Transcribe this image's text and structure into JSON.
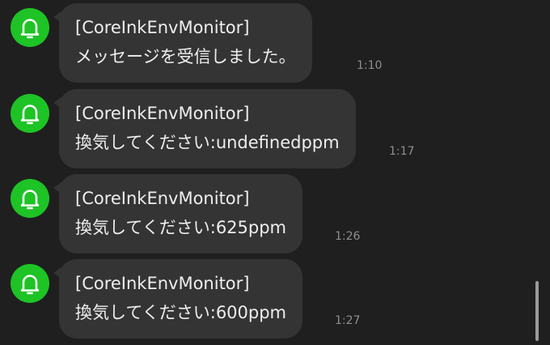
{
  "messages": [
    {
      "sender": "[CoreInkEnvMonitor]",
      "text": "メッセージを受信しました。",
      "time": "1:10"
    },
    {
      "sender": "[CoreInkEnvMonitor]",
      "text": "換気してください:undefinedppm",
      "time": "1:17"
    },
    {
      "sender": "[CoreInkEnvMonitor]",
      "text": "換気してください:625ppm",
      "time": "1:26"
    },
    {
      "sender": "[CoreInkEnvMonitor]",
      "text": "換気してください:600ppm",
      "time": "1:27"
    }
  ],
  "avatar": {
    "icon": "bell-icon",
    "color": "#1ec325"
  },
  "colors": {
    "background": "#1f1f1f",
    "bubble": "#343434",
    "text": "#eeeeee",
    "time": "#8e8e8e"
  }
}
